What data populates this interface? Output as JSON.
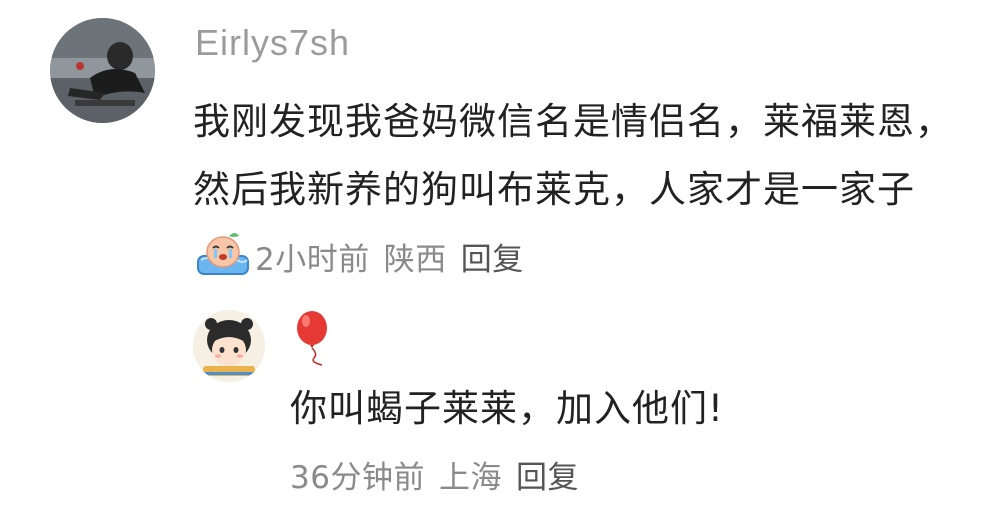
{
  "comment": {
    "username": "Eirlys7sh",
    "text": "我刚发现我爸妈微信名是情侣名，莱福莱恩，然后我新养的狗叫布莱克，人家才是一家子",
    "emoji": "crying-emoji",
    "time": "2小时前",
    "location": "陕西",
    "reply_label": "回复"
  },
  "reply": {
    "badge": "balloon-icon",
    "text": "你叫蝎子莱莱，加入他们!",
    "time": "36分钟前",
    "location": "上海",
    "reply_label": "回复"
  }
}
